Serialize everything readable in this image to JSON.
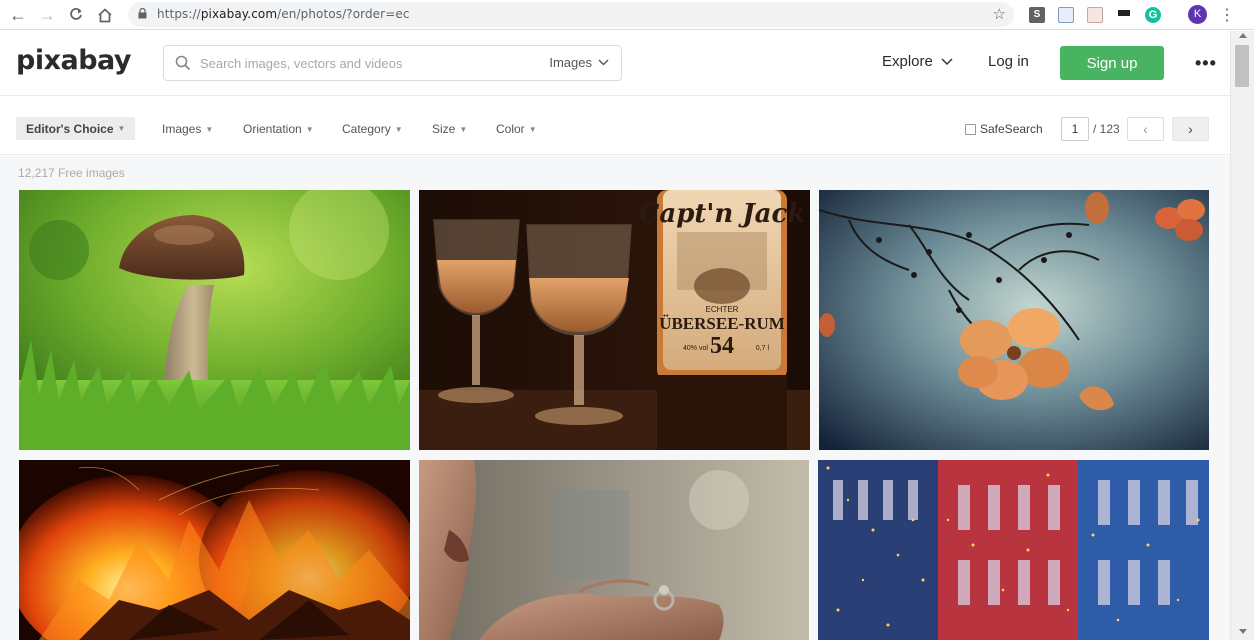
{
  "browser": {
    "url_prefix": "https://",
    "url_host": "pixabay.com",
    "url_path": "/en/photos/?order=ec",
    "profile_initial": "K"
  },
  "header": {
    "logo": "pixabay",
    "search_placeholder": "Search images, vectors and videos",
    "search_type": "Images",
    "explore": "Explore",
    "login": "Log in",
    "signup": "Sign up"
  },
  "filters": {
    "editors_choice": "Editor's Choice",
    "items": [
      "Images",
      "Orientation",
      "Category",
      "Size",
      "Color"
    ],
    "safesearch": "SafeSearch",
    "page_current": "1",
    "page_total": "/ 123"
  },
  "results": {
    "count": "12,217 Free images",
    "images": [
      {
        "subject": "mushroom"
      },
      {
        "subject": "rum-glasses",
        "bottle_brand": "Capt'n Jack",
        "bottle_line1": "ECHTER",
        "bottle_line2": "ÜBERSEE-RUM",
        "bottle_number": "54",
        "bottle_volume_left": "40% vol",
        "bottle_volume_right": "0,7 l"
      },
      {
        "subject": "orange-flowers"
      },
      {
        "subject": "fire"
      },
      {
        "subject": "ring-hand"
      },
      {
        "subject": "colorful-building"
      }
    ]
  },
  "colors": {
    "accent_green": "#48b461"
  }
}
